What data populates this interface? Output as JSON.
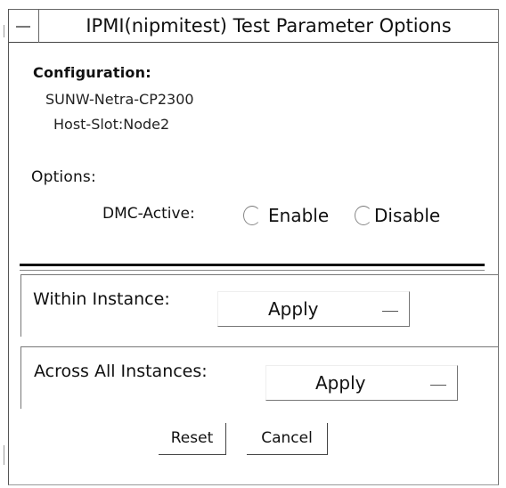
{
  "window": {
    "title": "IPMI(nipmitest) Test Parameter Options"
  },
  "configuration": {
    "heading": "Configuration:",
    "lines": [
      "SUNW-Netra-CP2300",
      "Host-Slot:Node2"
    ]
  },
  "options": {
    "heading": "Options:",
    "dmc_label": "DMC-Active:",
    "radio_enable": "Enable",
    "radio_disable": "Disable",
    "selected": "none"
  },
  "within_instance": {
    "label": "Within Instance:",
    "value": "Apply"
  },
  "across_instances": {
    "label": "Across All Instances:",
    "value": "Apply"
  },
  "buttons": {
    "reset": "Reset",
    "cancel": "Cancel"
  },
  "icons": {
    "window_menu": "window-menu-icon",
    "dropdown": "option-menu-indicator-icon"
  }
}
